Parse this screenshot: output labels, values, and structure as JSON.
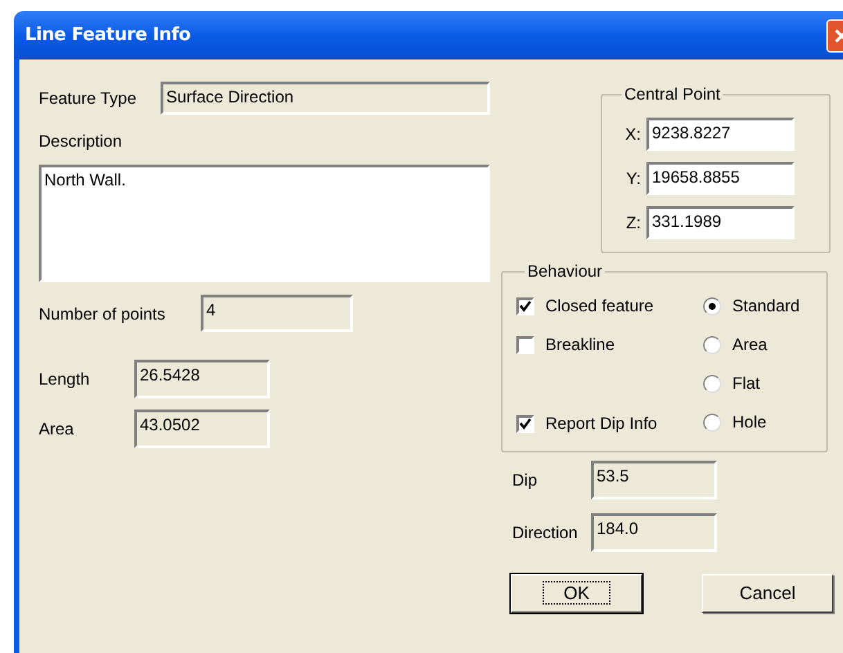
{
  "window": {
    "title": "Line Feature Info"
  },
  "feature_type": {
    "label": "Feature Type",
    "value": "Surface Direction"
  },
  "description": {
    "label": "Description",
    "value": "North Wall."
  },
  "number_of_points": {
    "label": "Number of points",
    "value": "4"
  },
  "length": {
    "label": "Length",
    "value": "26.5428"
  },
  "area": {
    "label": "Area",
    "value": "43.0502"
  },
  "central_point": {
    "title": "Central Point",
    "fields": [
      {
        "label": "X:",
        "value": "9238.8227"
      },
      {
        "label": "Y:",
        "value": "19658.8855"
      },
      {
        "label": "Z:",
        "value": "331.1989"
      }
    ]
  },
  "behaviour": {
    "title": "Behaviour",
    "checkboxes": [
      {
        "label": "Closed feature",
        "checked": true
      },
      {
        "label": "Breakline",
        "checked": false
      },
      {
        "label": "Report Dip Info",
        "checked": true
      }
    ],
    "options": [
      {
        "label": "Standard",
        "selected": true
      },
      {
        "label": "Area",
        "selected": false
      },
      {
        "label": "Flat",
        "selected": false
      },
      {
        "label": "Hole",
        "selected": false
      }
    ]
  },
  "dip": {
    "label": "Dip",
    "value": "53.5"
  },
  "direction": {
    "label": "Direction",
    "value": "184.0"
  },
  "buttons": [
    {
      "label": "OK",
      "default": true
    },
    {
      "label": "Cancel",
      "default": false
    }
  ]
}
